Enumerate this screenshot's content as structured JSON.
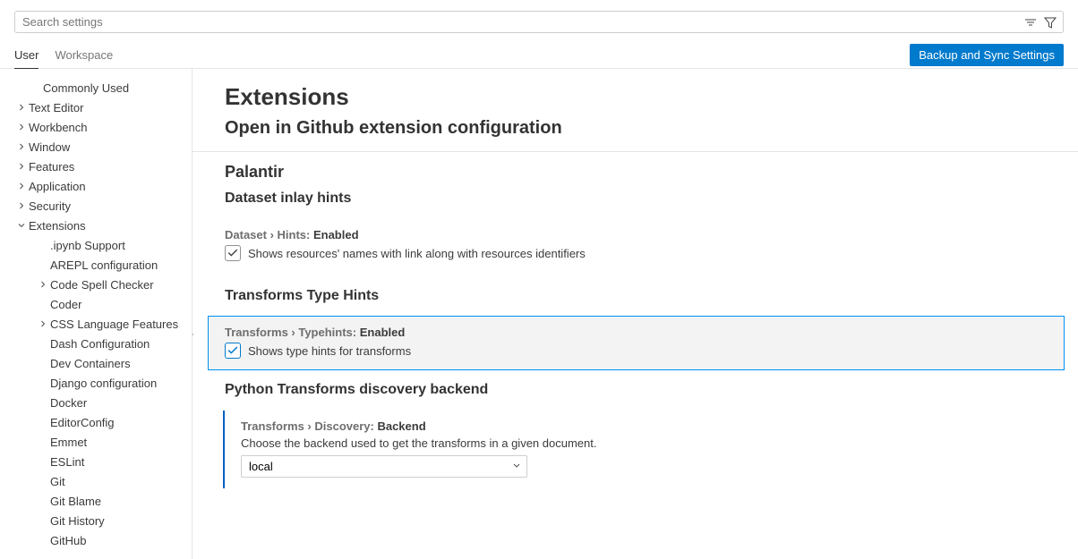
{
  "search": {
    "placeholder": "Search settings"
  },
  "tabs": {
    "user": "User",
    "workspace": "Workspace"
  },
  "syncButton": "Backup and Sync Settings",
  "sidebar": {
    "items": [
      {
        "label": "Commonly Used",
        "level": 1,
        "chev": null
      },
      {
        "label": "Text Editor",
        "level": 1,
        "chev": "right"
      },
      {
        "label": "Workbench",
        "level": 1,
        "chev": "right"
      },
      {
        "label": "Window",
        "level": 1,
        "chev": "right"
      },
      {
        "label": "Features",
        "level": 1,
        "chev": "right"
      },
      {
        "label": "Application",
        "level": 1,
        "chev": "right"
      },
      {
        "label": "Security",
        "level": 1,
        "chev": "right"
      },
      {
        "label": "Extensions",
        "level": 1,
        "chev": "down"
      },
      {
        "label": ".ipynb Support",
        "level": 2,
        "chev": null
      },
      {
        "label": "AREPL configuration",
        "level": 2,
        "chev": null
      },
      {
        "label": "Code Spell Checker",
        "level": 2,
        "chev": "right"
      },
      {
        "label": "Coder",
        "level": 2,
        "chev": null
      },
      {
        "label": "CSS Language Features",
        "level": 2,
        "chev": "right"
      },
      {
        "label": "Dash Configuration",
        "level": 2,
        "chev": null
      },
      {
        "label": "Dev Containers",
        "level": 2,
        "chev": null
      },
      {
        "label": "Django configuration",
        "level": 2,
        "chev": null
      },
      {
        "label": "Docker",
        "level": 2,
        "chev": null
      },
      {
        "label": "EditorConfig",
        "level": 2,
        "chev": null
      },
      {
        "label": "Emmet",
        "level": 2,
        "chev": null
      },
      {
        "label": "ESLint",
        "level": 2,
        "chev": null
      },
      {
        "label": "Git",
        "level": 2,
        "chev": null
      },
      {
        "label": "Git Blame",
        "level": 2,
        "chev": null
      },
      {
        "label": "Git History",
        "level": 2,
        "chev": null
      },
      {
        "label": "GitHub",
        "level": 2,
        "chev": null
      }
    ]
  },
  "content": {
    "h1": "Extensions",
    "h2_github": "Open in Github extension configuration",
    "h3_palantir": "Palantir",
    "h4_dataset": "Dataset inlay hints",
    "setting_dataset": {
      "prefix": "Dataset › Hints: ",
      "name": "Enabled",
      "desc": "Shows resources' names with link along with resources identifiers"
    },
    "h4_transforms": "Transforms Type Hints",
    "setting_transforms": {
      "prefix": "Transforms › Typehints: ",
      "name": "Enabled",
      "desc": "Shows type hints for transforms"
    },
    "h4_discovery": "Python Transforms discovery backend",
    "setting_discovery": {
      "prefix": "Transforms › Discovery: ",
      "name": "Backend",
      "desc": "Choose the backend used to get the transforms in a given document.",
      "value": "local"
    }
  }
}
